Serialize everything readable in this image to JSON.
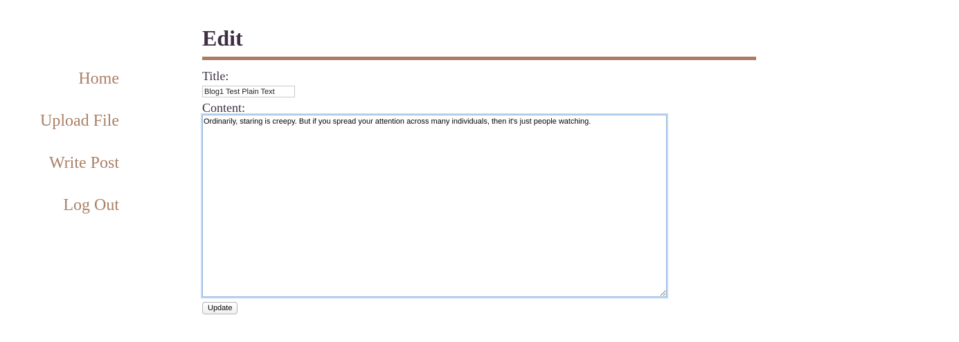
{
  "sidebar": {
    "items": [
      {
        "label": "Home"
      },
      {
        "label": "Upload File"
      },
      {
        "label": "Write Post"
      },
      {
        "label": "Log Out"
      }
    ]
  },
  "page": {
    "title": "Edit"
  },
  "form": {
    "title_label": "Title:",
    "title_value": "Blog1 Test Plain Text",
    "content_label": "Content:",
    "content_value": "Ordinarily, staring is creepy. But if you spread your attention across many individuals, then it's just people watching.",
    "update_label": "Update"
  },
  "colors": {
    "nav_link": "#ab8067",
    "heading": "#3d2e45",
    "rule": "#ab7c62",
    "focus_ring": "#8fb3de"
  }
}
